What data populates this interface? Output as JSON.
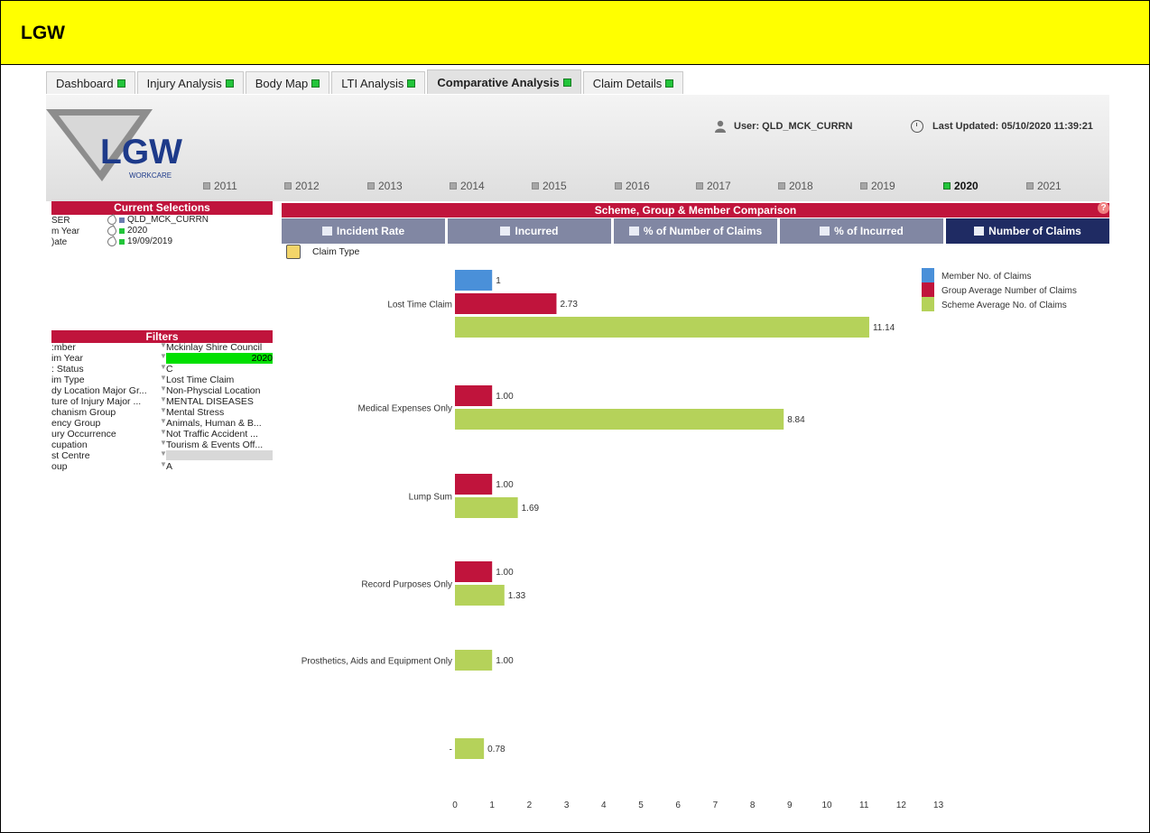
{
  "banner": {
    "title": "LGW"
  },
  "tabs": [
    {
      "label": "Dashboard"
    },
    {
      "label": "Injury Analysis"
    },
    {
      "label": "Body Map"
    },
    {
      "label": "LTI Analysis"
    },
    {
      "label": "Comparative Analysis",
      "active": true
    },
    {
      "label": "Claim Details"
    }
  ],
  "header": {
    "logo_text": "LGW",
    "logo_sub": "WORKCARE",
    "user": "User: QLD_MCK_CURRN",
    "updated": "Last Updated: 05/10/2020 11:39:21",
    "years": [
      "2011",
      "2012",
      "2013",
      "2014",
      "2015",
      "2016",
      "2017",
      "2018",
      "2019",
      "2020",
      "2021"
    ],
    "selected_year": "2020"
  },
  "current_selections": {
    "title": "Current Selections",
    "rows": [
      {
        "label": "SER",
        "value": "QLD_MCK_CURRN",
        "color": "#6b7db0"
      },
      {
        "label": "m Year",
        "value": "2020",
        "color": "#22c53a"
      },
      {
        "label": ")ate",
        "value": "19/09/2019",
        "color": "#22c53a"
      }
    ]
  },
  "filters": {
    "title": "Filters",
    "rows": [
      {
        "label": ":mber",
        "value": "Mckinlay Shire Council"
      },
      {
        "label": "im Year",
        "value": "2020",
        "highlight": true
      },
      {
        "label": ": Status",
        "value": "C"
      },
      {
        "label": "im Type",
        "value": "Lost Time Claim"
      },
      {
        "label": "dy Location Major Gr...",
        "value": "Non-Physcial Location"
      },
      {
        "label": "ture of Injury Major ...",
        "value": "MENTAL DISEASES"
      },
      {
        "label": "chanism Group",
        "value": "Mental Stress"
      },
      {
        "label": "ency Group",
        "value": "Animals, Human & B..."
      },
      {
        "label": "ury Occurrence",
        "value": "Not Traffic Accident ..."
      },
      {
        "label": "cupation",
        "value": "Tourism & Events Off..."
      },
      {
        "label": "st Centre",
        "value": "",
        "empty": true
      },
      {
        "label": "oup",
        "value": "A"
      }
    ]
  },
  "comparison": {
    "title": "Scheme, Group & Member Comparison",
    "tabs": [
      "Incident Rate",
      "Incurred",
      "% of Number of Claims",
      "% of Incurred",
      "Number of Claims"
    ],
    "active_tab": "Number of Claims",
    "dimension_label": "Claim Type",
    "help_glyph": "?"
  },
  "chart_data": {
    "type": "bar",
    "orientation": "horizontal",
    "categories": [
      "Lost Time Claim",
      "Medical Expenses Only",
      "Lump Sum",
      "Record Purposes Only",
      "Prosthetics, Aids and Equipment Only",
      "-"
    ],
    "series": [
      {
        "name": "Member No. of Claims",
        "color": "#4a90d9",
        "values": [
          1,
          null,
          null,
          null,
          null,
          null
        ],
        "labels": [
          "1",
          "",
          "",
          "",
          "",
          ""
        ]
      },
      {
        "name": "Group Average Number of Claims",
        "color": "#c0143c",
        "values": [
          2.73,
          1.0,
          1.0,
          1.0,
          null,
          null
        ],
        "labels": [
          "2.73",
          "1.00",
          "1.00",
          "1.00",
          "",
          ""
        ]
      },
      {
        "name": "Scheme Average No. of Claims",
        "color": "#b5d25a",
        "values": [
          11.14,
          8.84,
          1.69,
          1.33,
          1.0,
          0.78
        ],
        "labels": [
          "11.14",
          "8.84",
          "1.69",
          "1.33",
          "1.00",
          "0.78"
        ]
      }
    ],
    "xlim": [
      0,
      13
    ],
    "xticks": [
      0,
      1,
      2,
      3,
      4,
      5,
      6,
      7,
      8,
      9,
      10,
      11,
      12,
      13
    ],
    "legend_position": "top-right",
    "grid": false
  }
}
